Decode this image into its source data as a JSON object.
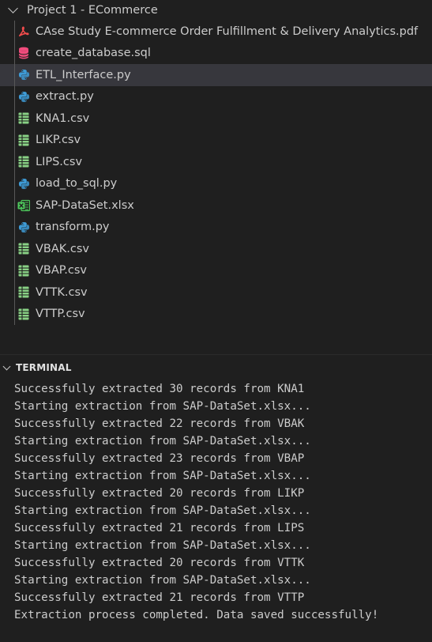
{
  "explorer": {
    "folder": {
      "name": "Project 1 - ECommerce",
      "expanded": true
    },
    "selected_index": 2,
    "files": [
      {
        "name": "CAse Study E-commerce Order Fulfillment & Delivery Analytics.pdf",
        "icon": "pdf-icon",
        "color": "#f14c4c"
      },
      {
        "name": "create_database.sql",
        "icon": "database-icon",
        "color": "#f14c7c"
      },
      {
        "name": "ETL_Interface.py",
        "icon": "python-icon",
        "color": "#3e9bd6"
      },
      {
        "name": "extract.py",
        "icon": "python-icon",
        "color": "#3e9bd6"
      },
      {
        "name": "KNA1.csv",
        "icon": "csv-icon",
        "color": "#89d185"
      },
      {
        "name": "LIKP.csv",
        "icon": "csv-icon",
        "color": "#89d185"
      },
      {
        "name": "LIPS.csv",
        "icon": "csv-icon",
        "color": "#89d185"
      },
      {
        "name": "load_to_sql.py",
        "icon": "python-icon",
        "color": "#3e9bd6"
      },
      {
        "name": "SAP-DataSet.xlsx",
        "icon": "excel-icon",
        "color": "#4ec95c"
      },
      {
        "name": "transform.py",
        "icon": "python-icon",
        "color": "#3e9bd6"
      },
      {
        "name": "VBAK.csv",
        "icon": "csv-icon",
        "color": "#89d185"
      },
      {
        "name": "VBAP.csv",
        "icon": "csv-icon",
        "color": "#89d185"
      },
      {
        "name": "VTTK.csv",
        "icon": "csv-icon",
        "color": "#89d185"
      },
      {
        "name": "VTTP.csv",
        "icon": "csv-icon",
        "color": "#89d185"
      }
    ]
  },
  "terminal": {
    "title": "TERMINAL",
    "lines": [
      "Successfully extracted 30 records from KNA1",
      "Starting extraction from SAP-DataSet.xlsx...",
      "Successfully extracted 22 records from VBAK",
      "Starting extraction from SAP-DataSet.xlsx...",
      "Successfully extracted 23 records from VBAP",
      "Starting extraction from SAP-DataSet.xlsx...",
      "Successfully extracted 20 records from LIKP",
      "Starting extraction from SAP-DataSet.xlsx...",
      "Successfully extracted 21 records from LIPS",
      "Starting extraction from SAP-DataSet.xlsx...",
      "Successfully extracted 20 records from VTTK",
      "Starting extraction from SAP-DataSet.xlsx...",
      "Successfully extracted 21 records from VTTP",
      "Extraction process completed. Data saved successfully!"
    ]
  }
}
